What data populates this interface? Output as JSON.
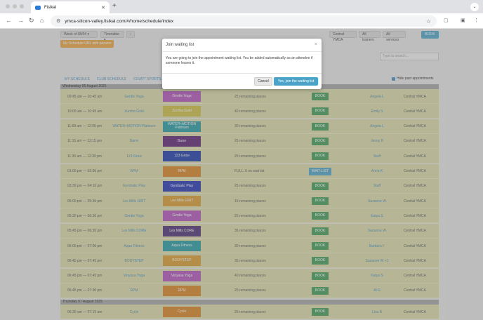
{
  "browser": {
    "tab_title": "Fisikal",
    "url": "ymca-silicon-valley.fisikal.com/#/home/schedule/index"
  },
  "controls": {
    "week": "Week of 08/04",
    "timetable": "Timetable",
    "location": "Central YMCA",
    "trainers": "All trainers",
    "services": "All services",
    "book": "BOOK",
    "schedule_url": "My Schedule URL with params",
    "search_placeholder": "Type to search...",
    "tabs": [
      "MY SCHEDULE",
      "CLUB SCHEDULE",
      "COURT SPORTS"
    ],
    "hide_past": "Hide past appointments"
  },
  "days": [
    {
      "label": "Wednesday 06 August 2025",
      "rows": [
        {
          "time": "09:45 am — 10:45 am",
          "name": "Gentle Yoga",
          "tag": "Gentle Yoga",
          "color": "#b24fbc",
          "places": "25 remaining places",
          "action": "BOOK",
          "coach": "Angela L",
          "loc": "Central YMCA"
        },
        {
          "time": "10:00 am — 10:45 am",
          "name": "Zumba Gold",
          "tag": "Zumba Gold",
          "color": "#cfbe3f",
          "places": "40 remaining places",
          "action": "BOOK",
          "coach": "Emily S",
          "loc": "Central YMCA"
        },
        {
          "time": "11:00 am — 12:00 pm",
          "name": "WATER≈MOTION Platinum",
          "tag": "WATER≈MOTION Platinum",
          "color": "#1f9aa0",
          "places": "30 remaining places",
          "action": "BOOK",
          "coach": "Angela L",
          "loc": "Central YMCA"
        },
        {
          "time": "11:15 am — 12:15 pm",
          "name": "Barre",
          "tag": "Barre",
          "color": "#5a1f70",
          "places": "25 remaining places",
          "action": "BOOK",
          "coach": "Jenny B",
          "loc": "Central YMCA"
        },
        {
          "time": "11:30 am — 12:30 pm",
          "name": "123 Grow",
          "tag": "123 Grow",
          "color": "#1535a8",
          "places": "25 remaining places",
          "action": "BOOK",
          "coach": "Staff",
          "loc": "Central YMCA"
        },
        {
          "time": "01:00 pm — 02:00 pm",
          "name": "RPM",
          "tag": "RPM",
          "color": "#d9821d",
          "places": "FULL. 0 on wait list",
          "action": "WAIT-LIST",
          "coach": "Anna K",
          "loc": "Central YMCA"
        },
        {
          "time": "03:30 pm — 04:10 pm",
          "name": "Gymbatic Play",
          "tag": "Gymbatic Play",
          "color": "#1f2fb0",
          "places": "25 remaining places",
          "action": "BOOK",
          "coach": "Staff",
          "loc": "Central YMCA"
        },
        {
          "time": "05:00 pm — 05:30 pm",
          "name": "Les Mills GRIT",
          "tag": "Les Mills GRIT",
          "color": "#d99a2a",
          "places": "15 remaining places",
          "action": "BOOK",
          "coach": "Suzanne W",
          "loc": "Central YMCA"
        },
        {
          "time": "05:30 pm — 06:30 pm",
          "name": "Gentle Yoga",
          "tag": "Gentle Yoga",
          "color": "#b24fbc",
          "places": "25 remaining places",
          "action": "BOOK",
          "coach": "Katya S",
          "loc": "Central YMCA"
        },
        {
          "time": "05:45 pm — 06:30 pm",
          "name": "Les Mills CORE",
          "tag": "Les Mills CORE",
          "color": "#4a2a72",
          "places": "35 remaining places",
          "action": "BOOK",
          "coach": "Suzanne W",
          "loc": "Central YMCA"
        },
        {
          "time": "06:00 pm — 07:00 pm",
          "name": "Aqua Fitness",
          "tag": "Aqua Fitness",
          "color": "#1f9aa0",
          "places": "30 remaining places",
          "action": "BOOK",
          "coach": "Barbara F",
          "loc": "Central YMCA"
        },
        {
          "time": "06:45 pm — 07:45 pm",
          "name": "BODYSTEP",
          "tag": "BODYSTEP",
          "color": "#d99a2a",
          "places": "35 remaining places",
          "action": "BOOK",
          "coach": "Suzanne W +1",
          "loc": "Central YMCA"
        },
        {
          "time": "06:45 pm — 07:45 pm",
          "name": "Vinyasa Yoga",
          "tag": "Vinyasa Yoga",
          "color": "#b24fbc",
          "places": "40 remaining places",
          "action": "BOOK",
          "coach": "Katya S",
          "loc": "Central YMCA"
        },
        {
          "time": "06:45 pm — 07:30 pm",
          "name": "RPM",
          "tag": "RPM",
          "color": "#d9821d",
          "places": "25 remaining places",
          "action": "BOOK",
          "coach": "Al G",
          "loc": "Central YMCA"
        }
      ]
    },
    {
      "label": "Thursday 07 August 2025",
      "rows": [
        {
          "time": "06:30 am — 07:15 am",
          "name": "Cycle",
          "tag": "Cycle",
          "color": "#d9821d",
          "places": "25 remaining places",
          "action": "BOOK",
          "coach": "Lisa B",
          "loc": "Central YMCA"
        }
      ]
    }
  ],
  "modal": {
    "title": "Join waiting list",
    "close": "×",
    "body": "You are going to join the appointment waiting list. You be added automatically as an attendee if someone leaves it.",
    "cancel": "Cancel",
    "confirm": "Yes, join the waiting list"
  }
}
